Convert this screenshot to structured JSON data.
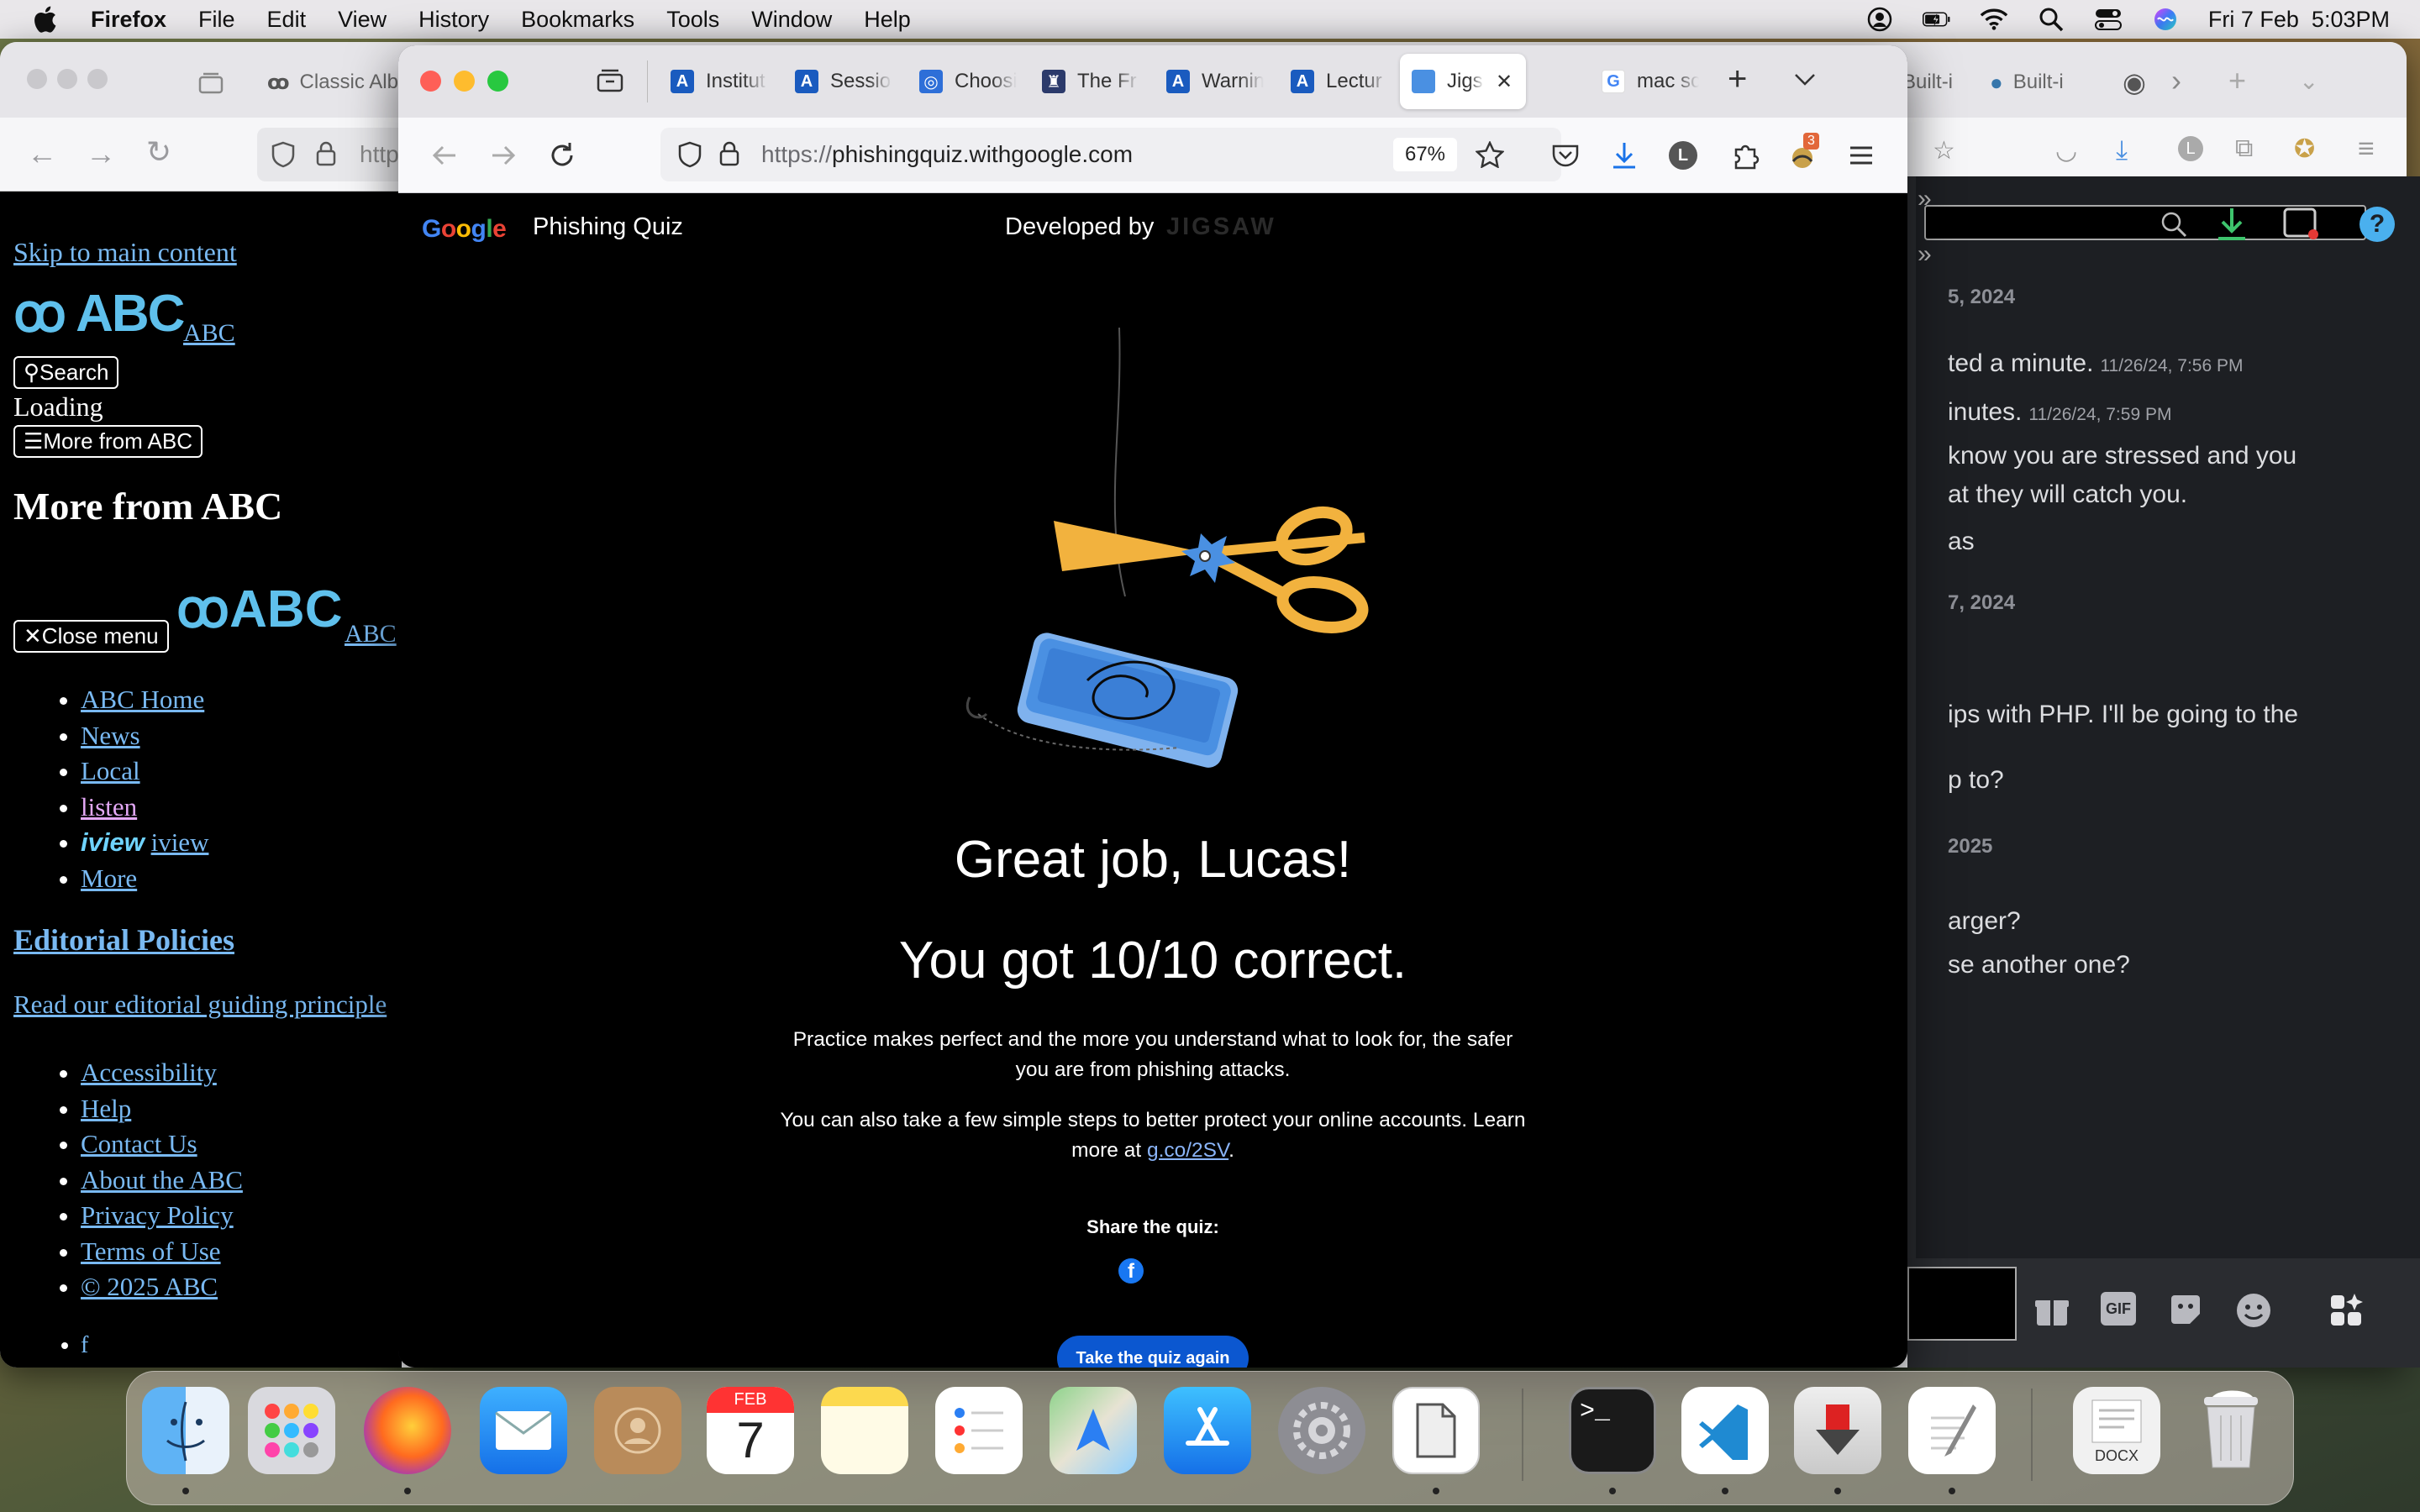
{
  "menubar": {
    "app": "Firefox",
    "items": [
      "File",
      "Edit",
      "View",
      "History",
      "Bookmarks",
      "Tools",
      "Window",
      "Help"
    ],
    "datetime": "Fri 7 Feb  5:03PM"
  },
  "background_window": {
    "tab_title": "Classic Alb",
    "url_fragment": "http",
    "abc_page": {
      "skip_link": "Skip to main content",
      "logo_text": "ABC",
      "abc_link": "ABC",
      "search_button": "Search",
      "loading": "Loading",
      "more_button": "More from ABC",
      "heading": "More from ABC",
      "close_menu": "Close menu",
      "nav_links": [
        "ABC Home",
        "News",
        "Local",
        "listen",
        "iview",
        "More"
      ],
      "iview_logo": "iview",
      "editorial_heading": "Editorial Policies",
      "editorial_link": "Read our editorial guiding principle",
      "footer_links": [
        "Accessibility",
        "Help",
        "Contact Us",
        "About the ABC",
        "Privacy Policy",
        "Terms of Use",
        "© 2025 ABC"
      ],
      "social": [
        "f",
        "▶"
      ]
    },
    "right_tabs": [
      "Built-i",
      "Built-i"
    ]
  },
  "chat": {
    "lines": [
      {
        "kind": "date",
        "text": "5, 2024"
      },
      {
        "kind": "msg",
        "text": "ted a minute.",
        "time": "11/26/24, 7:56 PM"
      },
      {
        "kind": "msg",
        "text": "inutes.",
        "time": "11/26/24, 7:59 PM"
      },
      {
        "kind": "msg",
        "text": "know you are stressed and you"
      },
      {
        "kind": "msg",
        "text": "at they will catch you."
      },
      {
        "kind": "msg",
        "text": "as"
      },
      {
        "kind": "date",
        "text": "7, 2024"
      },
      {
        "kind": "msg",
        "text": "ips with PHP. I'll be going to the"
      },
      {
        "kind": "msg",
        "text": "p to?"
      },
      {
        "kind": "date",
        "text": "2025"
      },
      {
        "kind": "msg",
        "text": "arger?"
      },
      {
        "kind": "msg",
        "text": "se another one?"
      }
    ],
    "composer_icons": [
      "gift-icon",
      "gif-icon",
      "sticker-icon",
      "emoji-icon",
      "apps-icon"
    ],
    "gif_label": "GIF"
  },
  "firefox": {
    "tabs": [
      {
        "title": "Institut",
        "fav_color": "#1a5bbf",
        "fav_char": "A"
      },
      {
        "title": "Sessio",
        "fav_color": "#1a5bbf",
        "fav_char": "A"
      },
      {
        "title": "Choosi",
        "fav_color": "#2e6fd8",
        "fav_char": "◎"
      },
      {
        "title": "The Fr",
        "fav_color": "#2b3a6b",
        "fav_char": "♜"
      },
      {
        "title": "Warnin",
        "fav_color": "#1a5bbf",
        "fav_char": "A"
      },
      {
        "title": "Lectur",
        "fav_color": "#1a5bbf",
        "fav_char": "A"
      },
      {
        "title": "Jigs",
        "fav_color": "#4a90e2",
        "fav_char": ""
      },
      {
        "title": "mac sc",
        "fav_color": "#ffffff",
        "fav_char": "G"
      }
    ],
    "url_scheme": "https://",
    "url_host": "phishingquiz.withgoogle.com",
    "zoom": "67%",
    "extension_badge": "3"
  },
  "quiz_page": {
    "brand": "Google",
    "product": "Phishing Quiz",
    "developed_by": "Developed by",
    "developer": "JIGSAW",
    "headline": "Great job, Lucas!",
    "score_line": "You got 10/10 correct.",
    "para1": "Practice makes perfect and the more you understand what to look for, the safer you are from phishing attacks.",
    "para2_prefix": "You can also take a few simple steps to better protect your online accounts. Learn more at ",
    "para2_link": "g.co/2SV",
    "para2_suffix": ".",
    "share_label": "Share the quiz:",
    "retake_button": "Take the quiz again"
  },
  "dock": {
    "calendar_month": "FEB",
    "calendar_day": "7",
    "docx_label": "DOCX"
  },
  "colors": {
    "google_blue": "#4285f4",
    "google_red": "#ea4335",
    "google_yellow": "#fbbc05",
    "google_green": "#34a853",
    "abc_link": "#79b9f2",
    "button_blue": "#0b57d0"
  }
}
